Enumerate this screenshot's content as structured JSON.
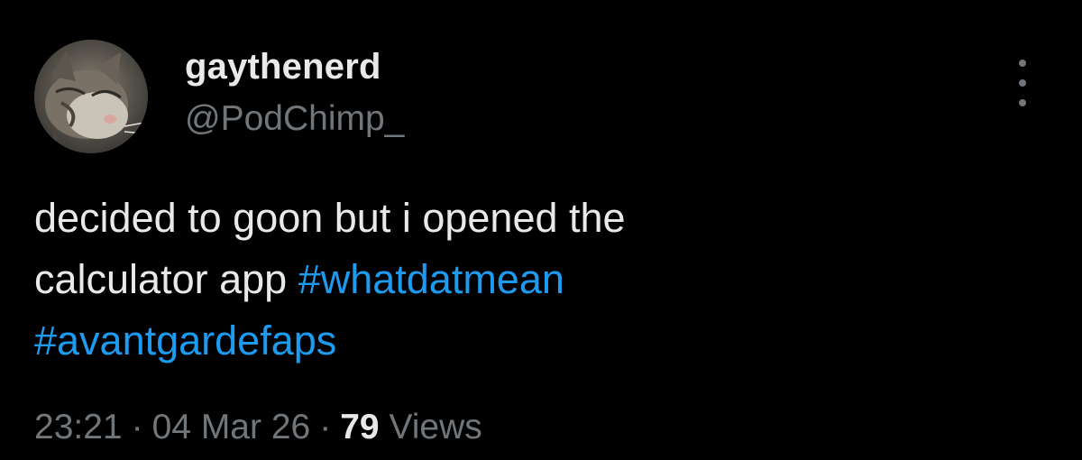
{
  "author": {
    "display_name": "gaythenerd",
    "handle": "@PodChimp_",
    "avatar_icon": "cat-avatar"
  },
  "tweet": {
    "line1": "decided to goon but i opened the",
    "line2_text": "calculator app ",
    "hashtag1": "#whatdatmean",
    "hashtag2": "#avantgardefaps"
  },
  "meta": {
    "time": "23:21",
    "separator": "·",
    "date": "04 Mar 26",
    "views_count": "79",
    "views_label": "Views"
  },
  "colors": {
    "background": "#000000",
    "text": "#e7e9ea",
    "secondary": "#71767b",
    "link": "#1d9bf0"
  },
  "icons": {
    "more": "more-vertical-icon"
  }
}
